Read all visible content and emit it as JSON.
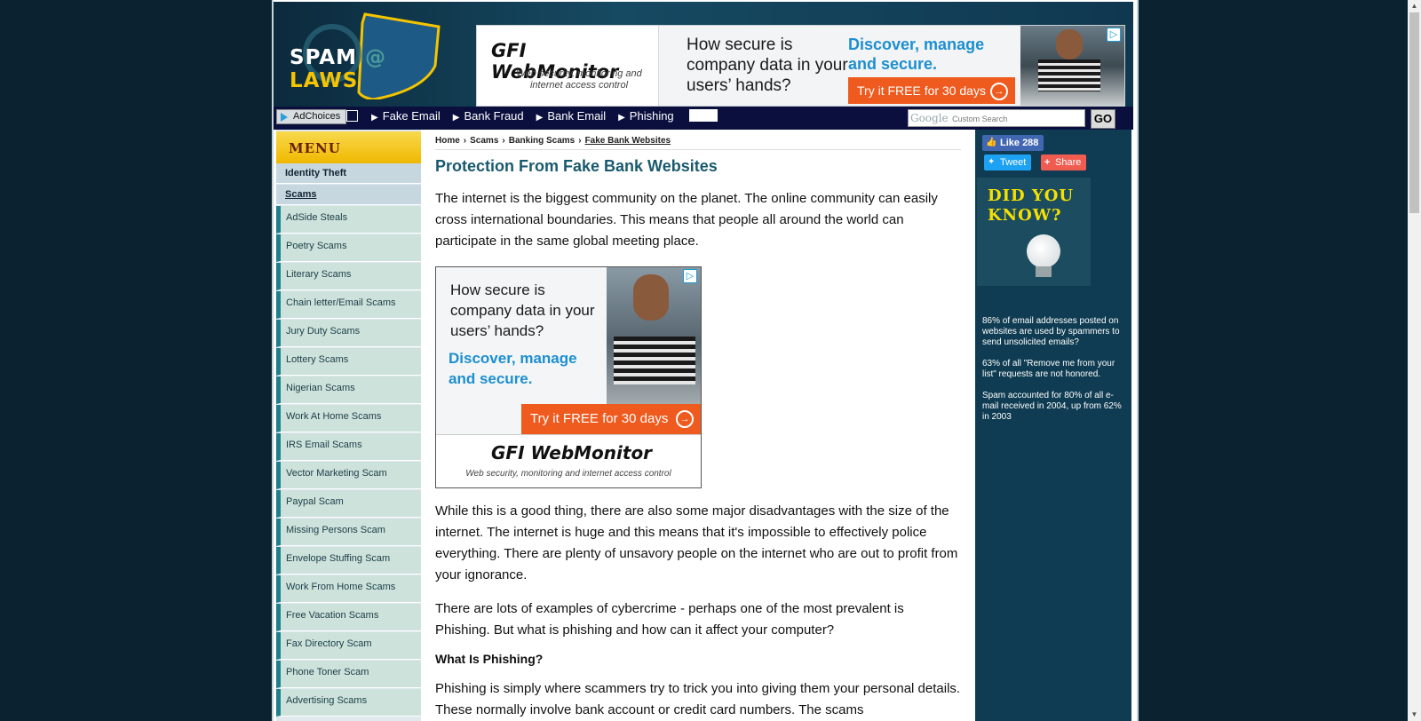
{
  "site": {
    "logo_word1": "SPAM",
    "logo_at": "@",
    "logo_word2": "LAWS"
  },
  "top_ad": {
    "brand": "GFI WebMonitor",
    "tagline": "Web security, monitoring and internet access control",
    "question": "How secure is company data in your users’ hands?",
    "discover": "Discover, manage and secure.",
    "cta": "Try it FREE for 30 days"
  },
  "navbar": {
    "adchoices_label": "AdChoices",
    "links": [
      "Fake Email",
      "Bank Fraud",
      "Bank Email",
      "Phishing"
    ],
    "search_logo": "Google",
    "search_placeholder": "Custom Search",
    "go_label": "GO"
  },
  "menu": {
    "title": "MENU",
    "top_items": [
      "Identity Theft",
      "Scams"
    ],
    "items": [
      "AdSide Steals",
      "Poetry Scams",
      "Literary Scams",
      "Chain letter/Email Scams",
      "Jury Duty Scams",
      "Lottery Scams",
      "Nigerian Scams",
      "Work At Home Scams",
      "IRS Email Scams",
      "Vector Marketing Scam",
      "Paypal Scam",
      "Missing Persons Scam",
      "Envelope Stuffing Scam",
      "Work From Home Scams",
      "Free Vacation Scams",
      "Fax Directory Scam",
      "Phone Toner Scam",
      "Advertising Scams"
    ]
  },
  "breadcrumb": [
    "Home",
    "Scams",
    "Banking Scams",
    "Fake Bank Websites"
  ],
  "article": {
    "title": "Protection From Fake Bank Websites",
    "p1": "The internet is the biggest community on the planet. The online community can easily cross international boundaries. This means that people all around the world can participate in the same global meeting place.",
    "p2": "While this is a good thing, there are also some major disadvantages with the size of the internet. The internet is huge and this means that it's impossible to effectively police everything. There are plenty of unsavory people on the internet who are out to profit from your ignorance.",
    "p3": "There are lots of examples of cybercrime - perhaps one of the most prevalent is Phishing. But what is phishing and how can it affect your computer?",
    "h3": "What Is Phishing?",
    "p4": "Phishing is simply where scammers try to trick you into giving them your personal details. These normally involve bank account or credit card numbers. The scams"
  },
  "mid_ad": {
    "question": "How secure is company data in your users’ hands?",
    "discover": "Discover, manage and secure.",
    "cta": "Try it FREE for 30 days",
    "brand": "GFI WebMonitor",
    "tagline": "Web security, monitoring and internet access control"
  },
  "social": {
    "like_label": "Like 288",
    "tweet_label": "Tweet",
    "share_label": "Share"
  },
  "sidebar": {
    "did_you_know": "DID YOU KNOW?",
    "facts": [
      "86% of email addresses posted on websites are used by spammers to send unsolicited emails?",
      "63% of all \"Remove me from your list\" requests are not honored.",
      "Spam accounted for 80% of all e-mail received in 2004, up from 62% in 2003"
    ]
  }
}
